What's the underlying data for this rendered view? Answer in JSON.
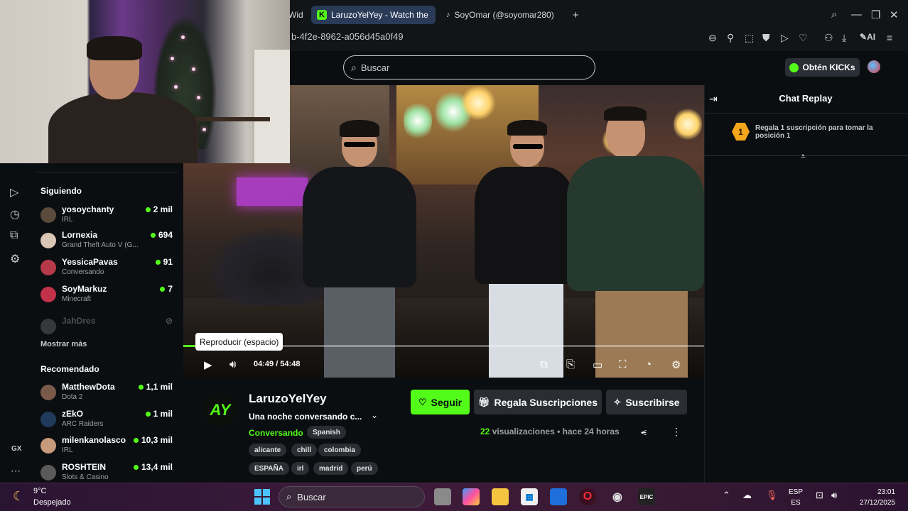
{
  "browser": {
    "tabs": [
      {
        "label": "Wid"
      },
      {
        "label": "LaruzoYelYey - Watch the"
      },
      {
        "label": "SoyOmar (@soyomar280)"
      }
    ],
    "new_tab": "+",
    "url": "b-4f2e-8962-a056d45a0f49",
    "ai_label": "AI"
  },
  "header": {
    "search_placeholder": "Buscar",
    "kicks_label": "Obtén KICKs"
  },
  "sidebar": {
    "following_title": "Siguiendo",
    "following": [
      {
        "name": "yosoychanty",
        "sub": "IRL",
        "viewers": "2 mil",
        "live": true,
        "color": "#5a4b3c"
      },
      {
        "name": "Lornexia",
        "sub": "Grand Theft Auto V (G...",
        "viewers": "694",
        "live": true,
        "color": "#d9c6b5"
      },
      {
        "name": "YessicaPavas",
        "sub": "Conversando",
        "viewers": "91",
        "live": true,
        "color": "#b73a4a"
      },
      {
        "name": "SoyMarkuz",
        "sub": "Minecraft",
        "viewers": "7",
        "live": true,
        "color": "#c2324a"
      },
      {
        "name": "JahDres",
        "sub": "",
        "viewers": "",
        "live": false,
        "color": "#888888"
      }
    ],
    "show_more": "Mostrar más",
    "recommended_title": "Recomendado",
    "recommended": [
      {
        "name": "MatthewDota",
        "sub": "Dota 2",
        "viewers": "1,1 mil",
        "color": "#7a5a4a"
      },
      {
        "name": "zEkO",
        "sub": "ARC Raiders",
        "viewers": "1 mil",
        "color": "#1f3a5a"
      },
      {
        "name": "milenkanolasco",
        "sub": "IRL",
        "viewers": "10,3 mil",
        "color": "#c69a7a"
      },
      {
        "name": "ROSHTEIN",
        "sub": "Slots & Casino",
        "viewers": "13,4 mil",
        "color": "#5a5a5a"
      }
    ],
    "gx_label": "GX"
  },
  "player": {
    "tooltip": "Reproducir (espacio)",
    "time": "04:49 / 54:48",
    "progress": 0.088
  },
  "chat": {
    "title": "Chat Replay",
    "gift_rank": "1",
    "gift_text": "Regala 1 suscripción para tomar la posición 1"
  },
  "channel": {
    "logo_text": "AY",
    "name": "LaruzoYelYey",
    "title": "Una noche conversando c...",
    "category": "Conversando",
    "language": "Spanish",
    "tags": [
      "alicante",
      "chill",
      "colombia",
      "ESPAÑA",
      "irl",
      "madrid",
      "perú"
    ],
    "follow_label": "Seguir",
    "gift_subs_label": "Regala Suscripciones",
    "subscribe_label": "Suscribirse",
    "views_count": "22",
    "views_label": "visualizaciones",
    "separator": "•",
    "time_ago": "hace 24 horas"
  },
  "taskbar": {
    "temp": "9°C",
    "weather": "Despejado",
    "search_placeholder": "Buscar",
    "lang_top": "ESP",
    "lang_bottom": "ES",
    "time": "23:01",
    "date": "27/12/2025"
  },
  "colors": {
    "kick_green": "#53fc18",
    "background": "#0b0e11"
  }
}
